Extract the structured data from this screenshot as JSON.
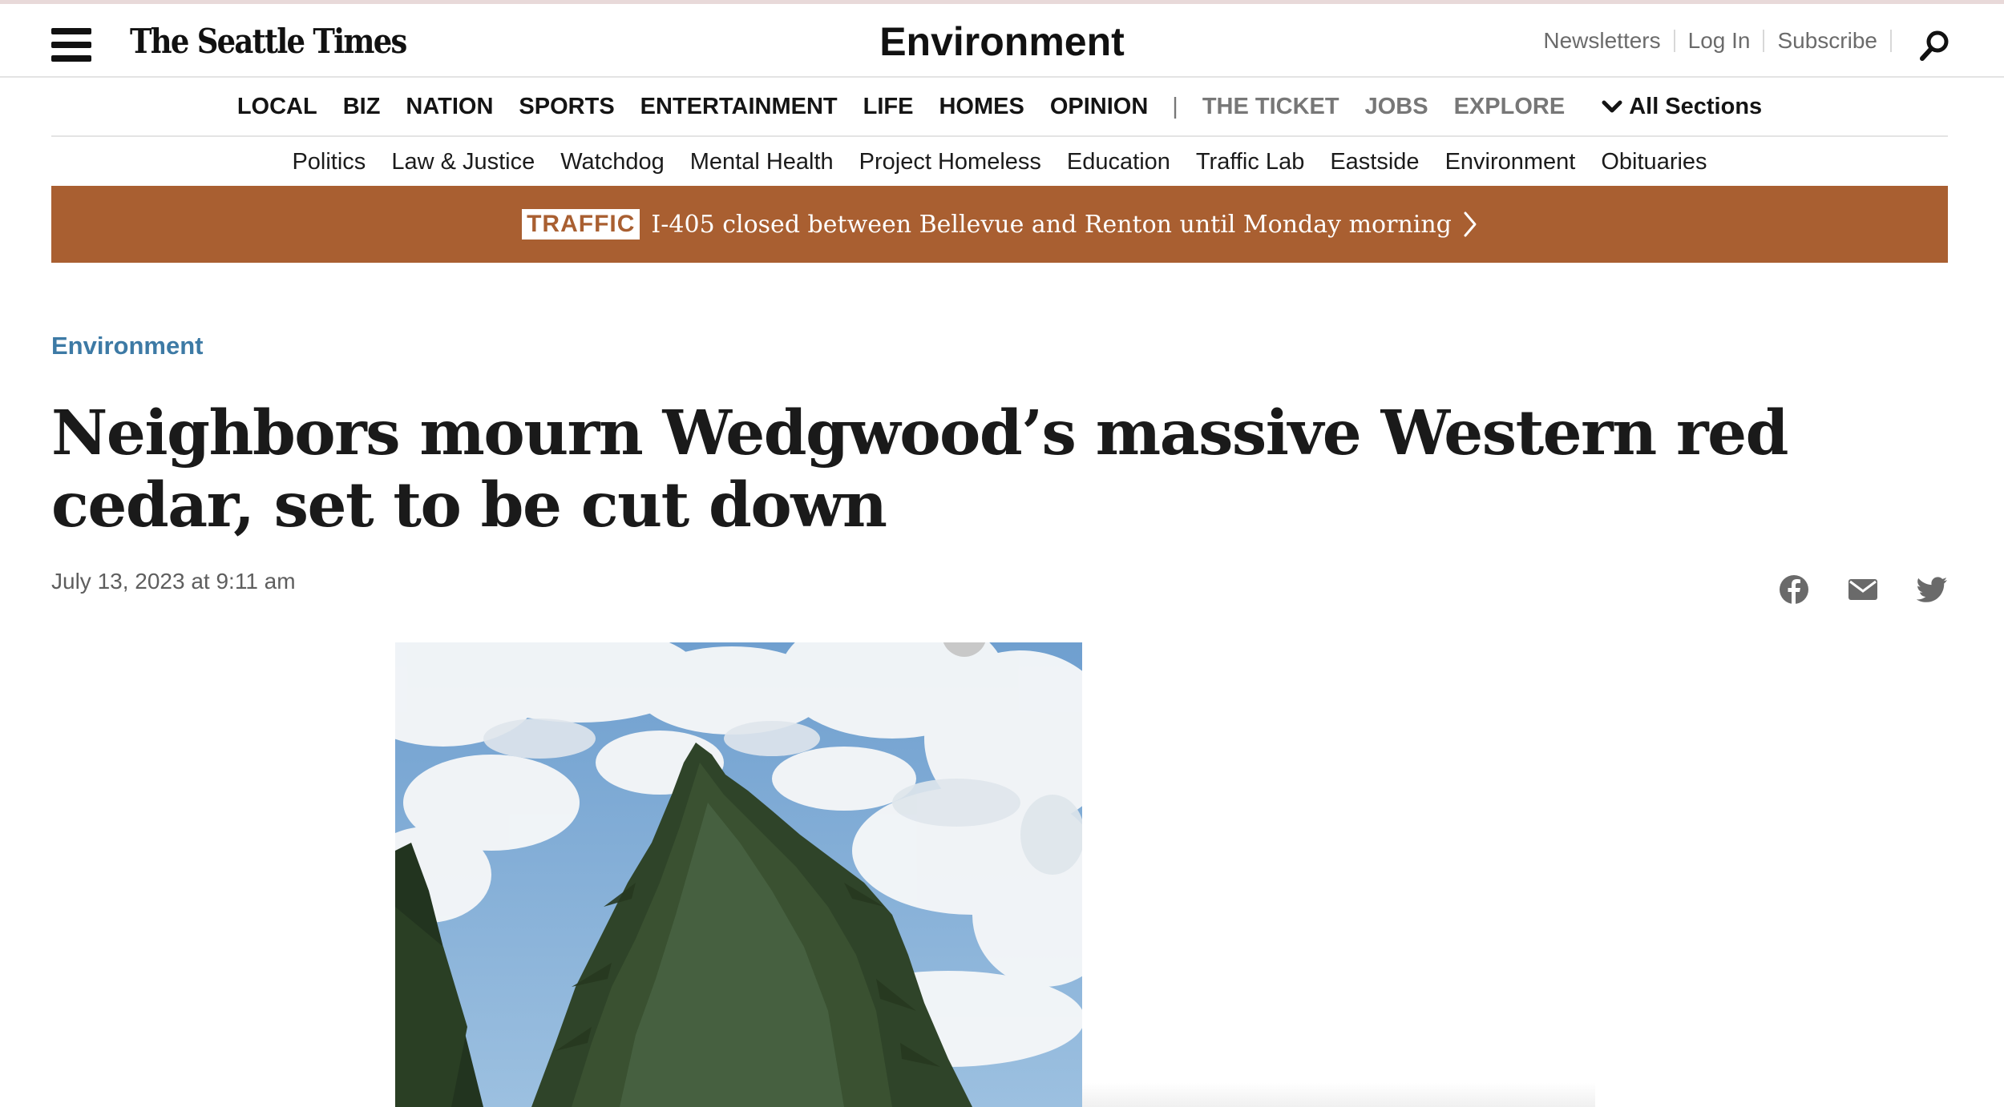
{
  "brand": {
    "logo_text": "The Seattle Times"
  },
  "header": {
    "section_title": "Environment",
    "utility_links": [
      "Newsletters",
      "Log In",
      "Subscribe"
    ]
  },
  "nav_primary": {
    "items": [
      "LOCAL",
      "BIZ",
      "NATION",
      "SPORTS",
      "ENTERTAINMENT",
      "LIFE",
      "HOMES",
      "OPINION"
    ],
    "divider": "|",
    "secondary_items": [
      "THE TICKET",
      "JOBS",
      "EXPLORE"
    ],
    "all_sections_label": "All Sections"
  },
  "nav_secondary": {
    "items": [
      "Politics",
      "Law & Justice",
      "Watchdog",
      "Mental Health",
      "Project Homeless",
      "Education",
      "Traffic Lab",
      "Eastside",
      "Environment",
      "Obituaries"
    ]
  },
  "alert": {
    "tag": "TRAFFIC",
    "message": "I-405 closed between Bellevue and Renton until Monday morning",
    "color": "#a95f31"
  },
  "article": {
    "kicker": "Environment",
    "headline": "Neighbors mourn Wedgwood’s massive Western red cedar, set to be cut down",
    "dateline": "July 13, 2023 at 9:11 am",
    "share_icons": [
      "facebook-icon",
      "email-icon",
      "twitter-icon"
    ]
  },
  "colors": {
    "kicker": "#3d7aa5",
    "muted_nav": "#777777",
    "banner": "#a95f31"
  }
}
